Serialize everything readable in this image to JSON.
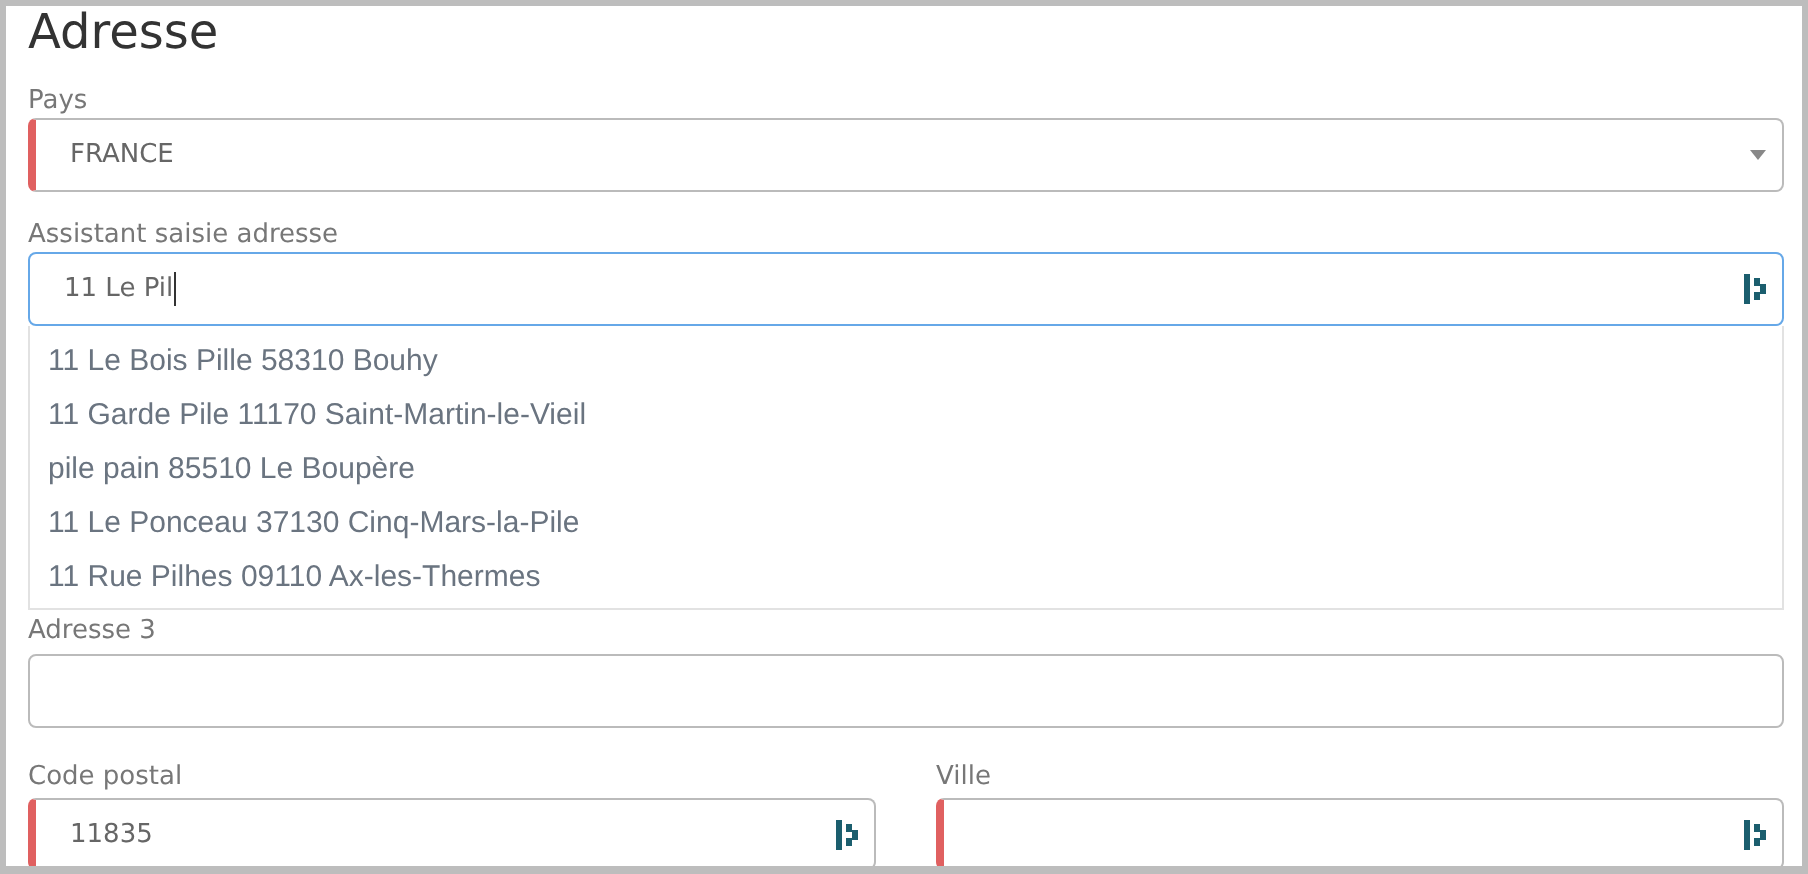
{
  "title": "Adresse",
  "country": {
    "label": "Pays",
    "value": "FRANCE",
    "required": true
  },
  "assistant": {
    "label": "Assistant saisie adresse",
    "value": "11 Le Pil",
    "focused": true,
    "suggestions": [
      "11 Le Bois Pille 58310 Bouhy",
      "11 Garde Pile 11170 Saint-Martin-le-Vieil",
      "pile pain 85510 Le Boupère",
      "11 Le Ponceau 37130 Cinq-Mars-la-Pile",
      "11 Rue Pilhes 09110 Ax-les-Thermes"
    ]
  },
  "address3": {
    "label": "Adresse 3",
    "required": false
  },
  "postal_code": {
    "label": "Code postal",
    "value": "11835",
    "required": true
  },
  "city": {
    "label": "Ville",
    "required": true
  }
}
